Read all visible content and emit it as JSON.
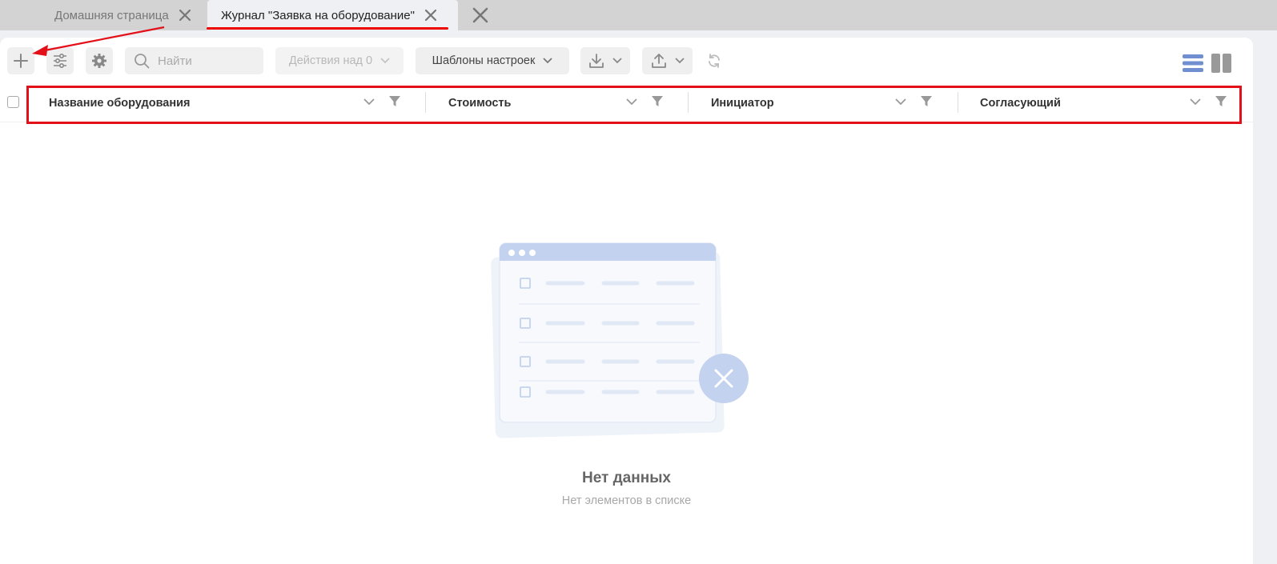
{
  "tabs": [
    {
      "label": "Домашняя страница",
      "active": false
    },
    {
      "label": "Журнал \"Заявка на оборудование\"",
      "active": true
    }
  ],
  "toolbar": {
    "search_placeholder": "Найти",
    "actions_label": "Действия над 0",
    "templates_label": "Шаблоны настроек"
  },
  "columns": [
    {
      "label": "Название оборудования"
    },
    {
      "label": "Стоимость"
    },
    {
      "label": "Инициатор"
    },
    {
      "label": "Согласующий"
    }
  ],
  "empty_state": {
    "title": "Нет данных",
    "subtitle": "Нет элементов в списке"
  },
  "colors": {
    "accent_red": "#e3101a",
    "empty_illustration": "#c3d2ee",
    "view_icon_active": "#6f8fd1",
    "view_icon_inactive": "#999999"
  },
  "icons": [
    "plus-icon",
    "sliders-icon",
    "gear-icon",
    "search-icon",
    "download-icon",
    "upload-icon",
    "refresh-icon",
    "list-view-icon",
    "columns-view-icon",
    "filter-icon",
    "chevron-down-icon",
    "close-icon"
  ]
}
